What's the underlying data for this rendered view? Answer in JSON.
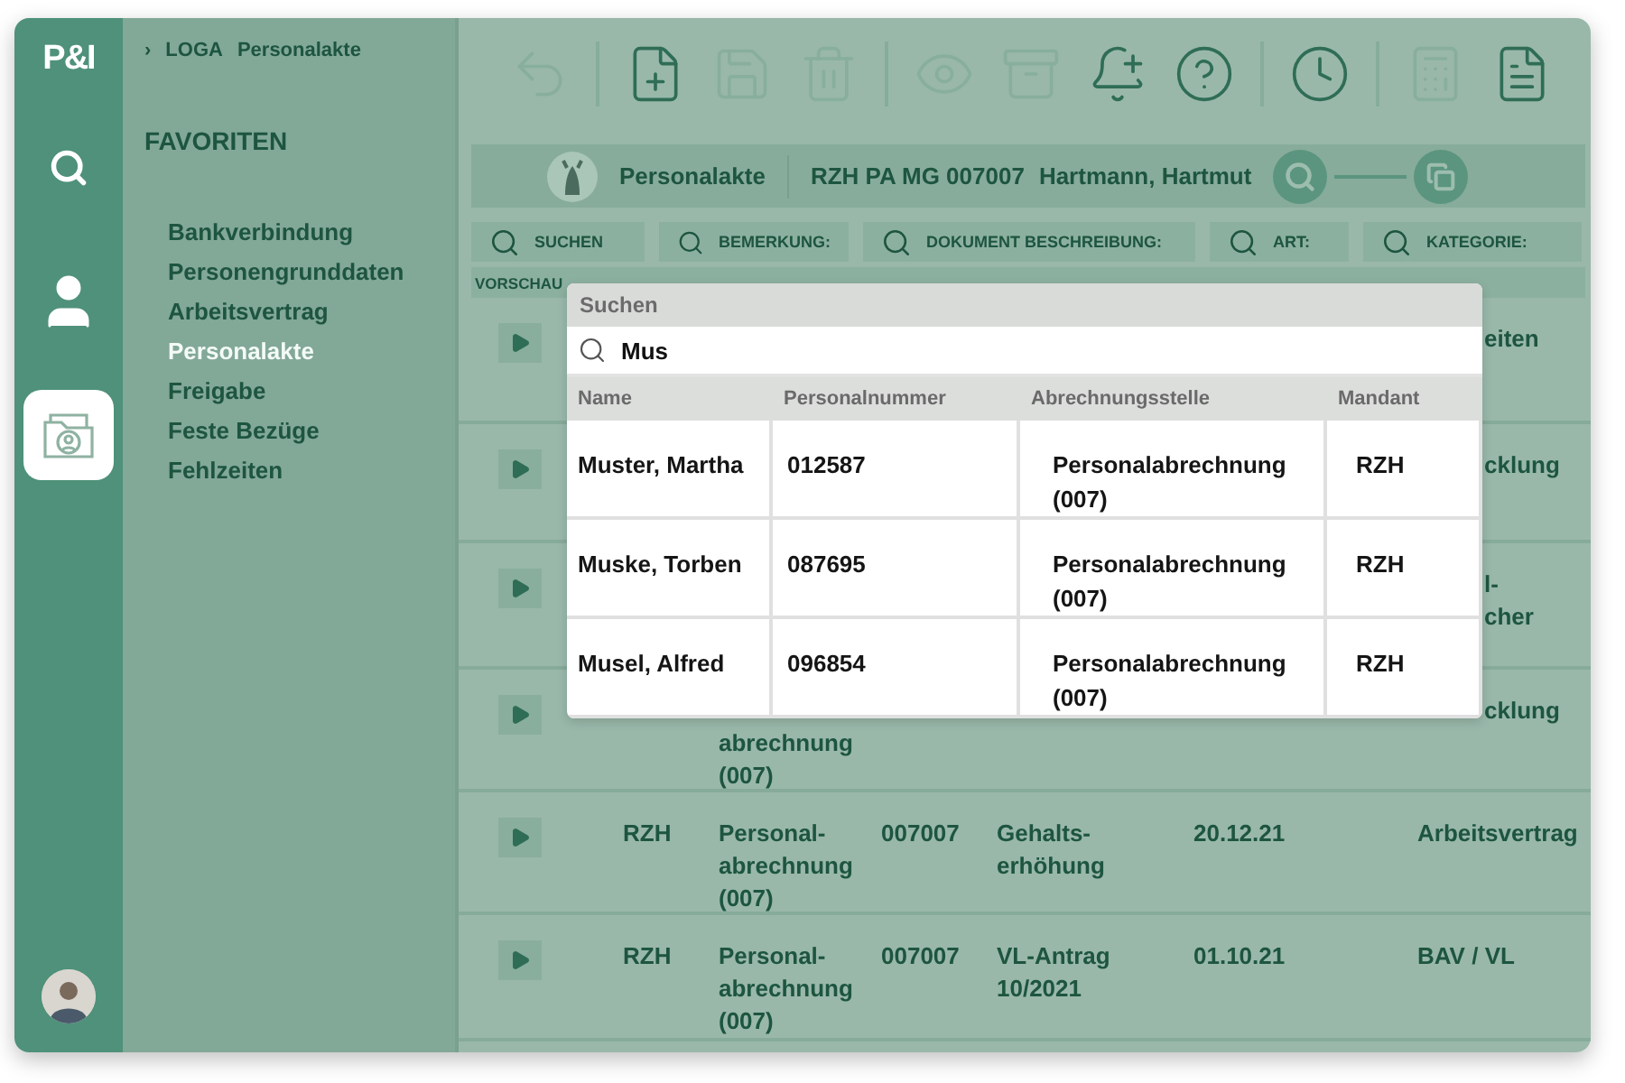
{
  "breadcrumb": [
    "›",
    "LOGA",
    "Personalakte"
  ],
  "rail": {
    "logo": "P&I",
    "items": [
      {
        "kind": "search",
        "selected": false
      },
      {
        "kind": "person",
        "selected": false
      },
      {
        "kind": "folder",
        "selected": true
      }
    ]
  },
  "sidebar": {
    "title": "FAVORITEN",
    "items": [
      {
        "label": "Bankverbindung",
        "selected": false
      },
      {
        "label": "Personengrunddaten",
        "selected": false
      },
      {
        "label": "Arbeitsvertrag",
        "selected": false
      },
      {
        "label": "Personalakte",
        "selected": true
      },
      {
        "label": "Freigabe",
        "selected": false
      },
      {
        "label": "Feste Bezüge",
        "selected": false
      },
      {
        "label": "Fehlzeiten",
        "selected": false
      }
    ]
  },
  "toolbar": [
    {
      "kind": "undo",
      "disabled": true
    },
    {
      "kind": "separator"
    },
    {
      "kind": "new",
      "disabled": false
    },
    {
      "kind": "save",
      "disabled": true
    },
    {
      "kind": "delete",
      "disabled": true
    },
    {
      "kind": "separator"
    },
    {
      "kind": "view",
      "disabled": true
    },
    {
      "kind": "archive",
      "disabled": true
    },
    {
      "kind": "reminder",
      "disabled": false
    },
    {
      "kind": "help",
      "disabled": false
    },
    {
      "kind": "separator"
    },
    {
      "kind": "history",
      "disabled": false
    },
    {
      "kind": "separator"
    },
    {
      "kind": "calculator",
      "disabled": true
    },
    {
      "kind": "document",
      "disabled": false
    }
  ],
  "record_bar": {
    "module": "Personalakte",
    "record_id": "RZH PA MG 007007",
    "person": "Hartmann, Hartmut"
  },
  "filters": [
    "SUCHEN",
    "BEMERKUNG:",
    "DOKUMENT BESCHREIBUNG:",
    "ART:",
    "KATEGORIE:"
  ],
  "table": {
    "columns": [
      "VORSCHAU"
    ],
    "rows": [
      {
        "kind": "partial",
        "mandant": [],
        "abrechnung": [],
        "person": [],
        "dokument": [],
        "gueltig": [],
        "art": [
          "eiten"
        ]
      },
      {
        "kind": "partial",
        "mandant": [],
        "abrechnung": [],
        "person": [],
        "dokument": [],
        "gueltig": [],
        "art": [
          "cklung"
        ]
      },
      {
        "kind": "partial",
        "mandant": [],
        "abrechnung": [],
        "person": [],
        "dokument": [],
        "gueltig": [],
        "art": [
          "l-",
          "cher"
        ]
      },
      {
        "kind": "partial",
        "mandant": [],
        "abrechnung": [
          "abrechnung",
          "(007)"
        ],
        "person": [],
        "dokument": [],
        "gueltig": [],
        "art": [
          "cklung"
        ]
      },
      {
        "kind": "full",
        "mandant": [
          "RZH"
        ],
        "abrechnung": [
          "Personal-",
          "abrechnung",
          "(007)"
        ],
        "person": [
          "007007"
        ],
        "dokument": [
          "Gehalts-",
          "erhöhung"
        ],
        "gueltig": [
          "20.12.21"
        ],
        "art": [
          "Arbeitsvertrag"
        ]
      },
      {
        "kind": "full",
        "mandant": [
          "RZH"
        ],
        "abrechnung": [
          "Personal-",
          "abrechnung",
          "(007)"
        ],
        "person": [
          "007007"
        ],
        "dokument": [
          "VL-Antrag",
          "10/2021"
        ],
        "gueltig": [
          "01.10.21"
        ],
        "art": [
          "BAV / VL"
        ]
      }
    ]
  },
  "search_popup": {
    "title": "Suchen",
    "query": "Mus",
    "columns": [
      "Name",
      "Personalnummer",
      "Abrechnungsstelle",
      "Mandant"
    ],
    "rows": [
      [
        "Muster, Martha",
        "012587",
        "Personalabrechnung (007)",
        "RZH"
      ],
      [
        "Muske, Torben",
        "087695",
        "Personalabrechnung (007)",
        "RZH"
      ],
      [
        "Musel, Alfred",
        "096854",
        "Personalabrechnung (007)",
        "RZH"
      ]
    ]
  }
}
